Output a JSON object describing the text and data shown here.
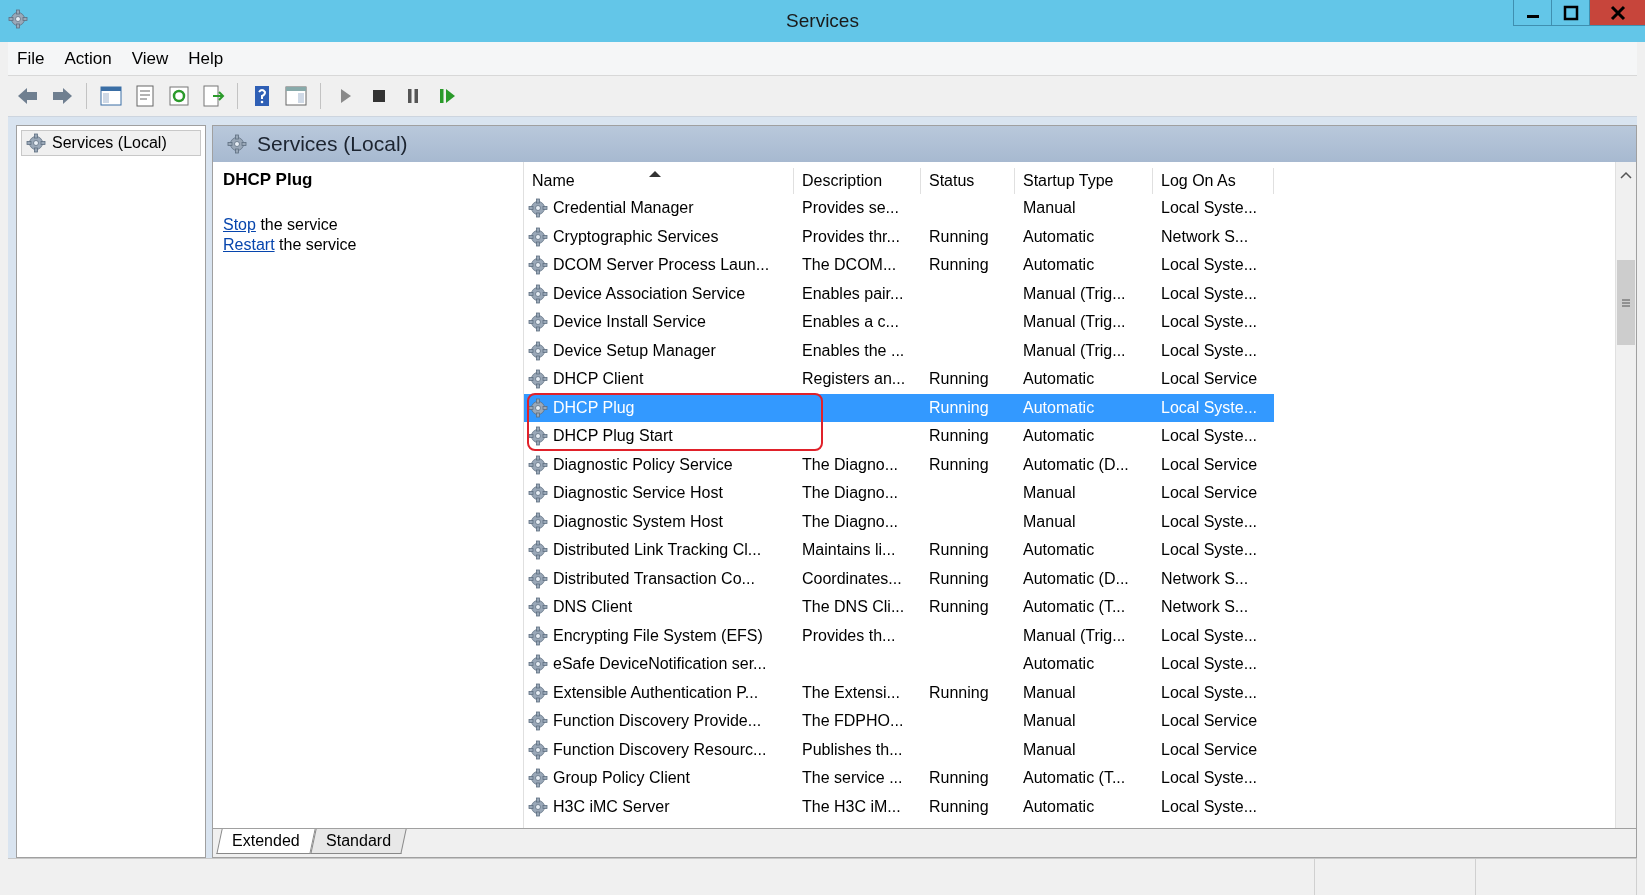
{
  "window": {
    "title": "Services"
  },
  "menu": [
    {
      "label": "File"
    },
    {
      "label": "Action"
    },
    {
      "label": "View"
    },
    {
      "label": "Help"
    }
  ],
  "tree": {
    "items": [
      {
        "label": "Services (Local)",
        "selected": true
      }
    ]
  },
  "panel": {
    "title": "Services (Local)"
  },
  "details": {
    "service_name": "DHCP Plug",
    "actions": [
      {
        "link": "Stop",
        "text": "the service"
      },
      {
        "link": "Restart",
        "text": "the service"
      }
    ]
  },
  "table": {
    "columns": [
      {
        "label": "Name",
        "sorted": true
      },
      {
        "label": "Description",
        "sorted": false
      },
      {
        "label": "Status",
        "sorted": false
      },
      {
        "label": "Startup Type",
        "sorted": false
      },
      {
        "label": "Log On As",
        "sorted": false
      }
    ],
    "rows": [
      {
        "name": "Credential Manager",
        "description": "Provides se...",
        "status": "",
        "startup_type": "Manual",
        "log_on_as": "Local Syste...",
        "selected": false
      },
      {
        "name": "Cryptographic Services",
        "description": "Provides thr...",
        "status": "Running",
        "startup_type": "Automatic",
        "log_on_as": "Network S...",
        "selected": false
      },
      {
        "name": "DCOM Server Process Laun...",
        "description": "The DCOM...",
        "status": "Running",
        "startup_type": "Automatic",
        "log_on_as": "Local Syste...",
        "selected": false
      },
      {
        "name": "Device Association Service",
        "description": "Enables pair...",
        "status": "",
        "startup_type": "Manual (Trig...",
        "log_on_as": "Local Syste...",
        "selected": false
      },
      {
        "name": "Device Install Service",
        "description": "Enables a c...",
        "status": "",
        "startup_type": "Manual (Trig...",
        "log_on_as": "Local Syste...",
        "selected": false
      },
      {
        "name": "Device Setup Manager",
        "description": "Enables the ...",
        "status": "",
        "startup_type": "Manual (Trig...",
        "log_on_as": "Local Syste...",
        "selected": false
      },
      {
        "name": "DHCP Client",
        "description": "Registers an...",
        "status": "Running",
        "startup_type": "Automatic",
        "log_on_as": "Local Service",
        "selected": false
      },
      {
        "name": "DHCP Plug",
        "description": "",
        "status": "Running",
        "startup_type": "Automatic",
        "log_on_as": "Local Syste...",
        "selected": true
      },
      {
        "name": "DHCP Plug Start",
        "description": "",
        "status": "Running",
        "startup_type": "Automatic",
        "log_on_as": "Local Syste...",
        "selected": false
      },
      {
        "name": "Diagnostic Policy Service",
        "description": "The Diagno...",
        "status": "Running",
        "startup_type": "Automatic (D...",
        "log_on_as": "Local Service",
        "selected": false
      },
      {
        "name": "Diagnostic Service Host",
        "description": "The Diagno...",
        "status": "",
        "startup_type": "Manual",
        "log_on_as": "Local Service",
        "selected": false
      },
      {
        "name": "Diagnostic System Host",
        "description": "The Diagno...",
        "status": "",
        "startup_type": "Manual",
        "log_on_as": "Local Syste...",
        "selected": false
      },
      {
        "name": "Distributed Link Tracking Cl...",
        "description": "Maintains li...",
        "status": "Running",
        "startup_type": "Automatic",
        "log_on_as": "Local Syste...",
        "selected": false
      },
      {
        "name": "Distributed Transaction Co...",
        "description": "Coordinates...",
        "status": "Running",
        "startup_type": "Automatic (D...",
        "log_on_as": "Network S...",
        "selected": false
      },
      {
        "name": "DNS Client",
        "description": "The DNS Cli...",
        "status": "Running",
        "startup_type": "Automatic (T...",
        "log_on_as": "Network S...",
        "selected": false
      },
      {
        "name": "Encrypting File System (EFS)",
        "description": "Provides th...",
        "status": "",
        "startup_type": "Manual (Trig...",
        "log_on_as": "Local Syste...",
        "selected": false
      },
      {
        "name": "eSafe DeviceNotification ser...",
        "description": "",
        "status": "",
        "startup_type": "Automatic",
        "log_on_as": "Local Syste...",
        "selected": false
      },
      {
        "name": "Extensible Authentication P...",
        "description": "The Extensi...",
        "status": "Running",
        "startup_type": "Manual",
        "log_on_as": "Local Syste...",
        "selected": false
      },
      {
        "name": "Function Discovery Provide...",
        "description": "The FDPHO...",
        "status": "",
        "startup_type": "Manual",
        "log_on_as": "Local Service",
        "selected": false
      },
      {
        "name": "Function Discovery Resourc...",
        "description": "Publishes th...",
        "status": "",
        "startup_type": "Manual",
        "log_on_as": "Local Service",
        "selected": false
      },
      {
        "name": "Group Policy Client",
        "description": "The service ...",
        "status": "Running",
        "startup_type": "Automatic (T...",
        "log_on_as": "Local Syste...",
        "selected": false
      },
      {
        "name": "H3C iMC Server",
        "description": "The H3C iM...",
        "status": "Running",
        "startup_type": "Automatic",
        "log_on_as": "Local Syste...",
        "selected": false
      }
    ]
  },
  "tabs": [
    {
      "label": "Extended",
      "selected": true
    },
    {
      "label": "Standard",
      "selected": false
    }
  ]
}
